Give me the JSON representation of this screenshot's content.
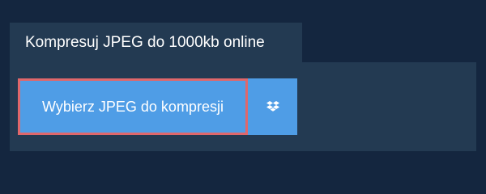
{
  "tab": {
    "title": "Kompresuj JPEG do 1000kb online"
  },
  "upload": {
    "choose_label": "Wybierz JPEG do kompresji",
    "dropbox_icon": "dropbox-icon"
  },
  "colors": {
    "page_background": "#14263f",
    "panel_background": "#233a52",
    "button_background": "#4f9de6",
    "focus_outline": "#e0676b",
    "text": "#ffffff"
  }
}
